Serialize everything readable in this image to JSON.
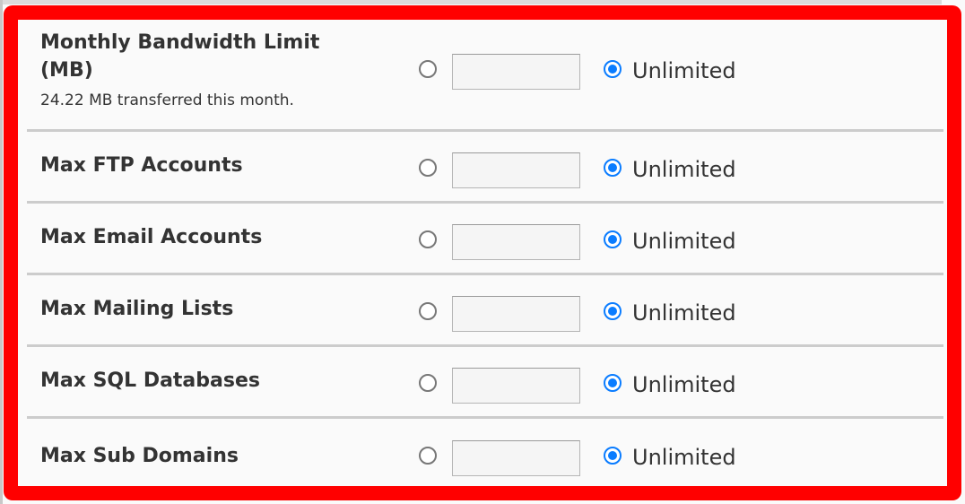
{
  "colors": {
    "highlight_border": "#ff0000",
    "radio_selected": "#0a7cff",
    "divider": "#cccccc",
    "text": "#333333"
  },
  "settings": [
    {
      "label": "Monthly Bandwidth Limit (MB)",
      "note": "24.22 MB transferred this month.",
      "limit_value": "",
      "unlimited_label": "Unlimited",
      "selected": "unlimited"
    },
    {
      "label": "Max FTP Accounts",
      "limit_value": "",
      "unlimited_label": "Unlimited",
      "selected": "unlimited"
    },
    {
      "label": "Max Email Accounts",
      "limit_value": "",
      "unlimited_label": "Unlimited",
      "selected": "unlimited"
    },
    {
      "label": "Max Mailing Lists",
      "limit_value": "",
      "unlimited_label": "Unlimited",
      "selected": "unlimited"
    },
    {
      "label": "Max SQL Databases",
      "limit_value": "",
      "unlimited_label": "Unlimited",
      "selected": "unlimited"
    },
    {
      "label": "Max Sub Domains",
      "limit_value": "",
      "unlimited_label": "Unlimited",
      "selected": "unlimited"
    }
  ]
}
